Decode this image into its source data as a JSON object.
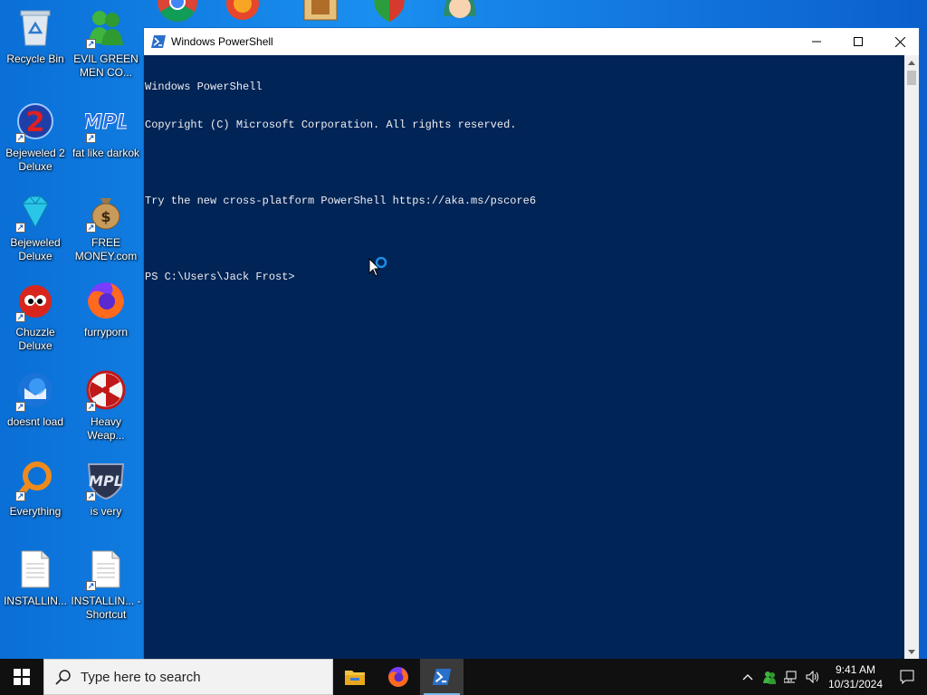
{
  "desktop": {
    "icons": [
      {
        "label": "Recycle Bin"
      },
      {
        "label": "EVIL GREEN MEN CO..."
      },
      {
        "label": "Bejeweled 2 Deluxe"
      },
      {
        "label": "fat like darkok"
      },
      {
        "label": "Bejeweled Deluxe"
      },
      {
        "label": "FREE MONEY.com"
      },
      {
        "label": "Chuzzle Deluxe"
      },
      {
        "label": "furryporn"
      },
      {
        "label": "doesnt load"
      },
      {
        "label": "Heavy Weap..."
      },
      {
        "label": "Everything"
      },
      {
        "label": "is very"
      },
      {
        "label": "INSTALLIN..."
      },
      {
        "label": "INSTALLIN... - Shortcut"
      }
    ]
  },
  "window": {
    "title": "Windows PowerShell",
    "console_lines": [
      "Windows PowerShell",
      "Copyright (C) Microsoft Corporation. All rights reserved.",
      "",
      "Try the new cross-platform PowerShell https://aka.ms/pscore6",
      "",
      "PS C:\\Users\\Jack Frost>"
    ]
  },
  "taskbar": {
    "search_placeholder": "Type here to search",
    "time": "9:41 AM",
    "date": "10/31/2024"
  },
  "colors": {
    "console_bg": "#012456",
    "console_text": "#eeedf0",
    "taskbar_bg": "#101010",
    "desktop_accent": "#0a6fd6"
  }
}
